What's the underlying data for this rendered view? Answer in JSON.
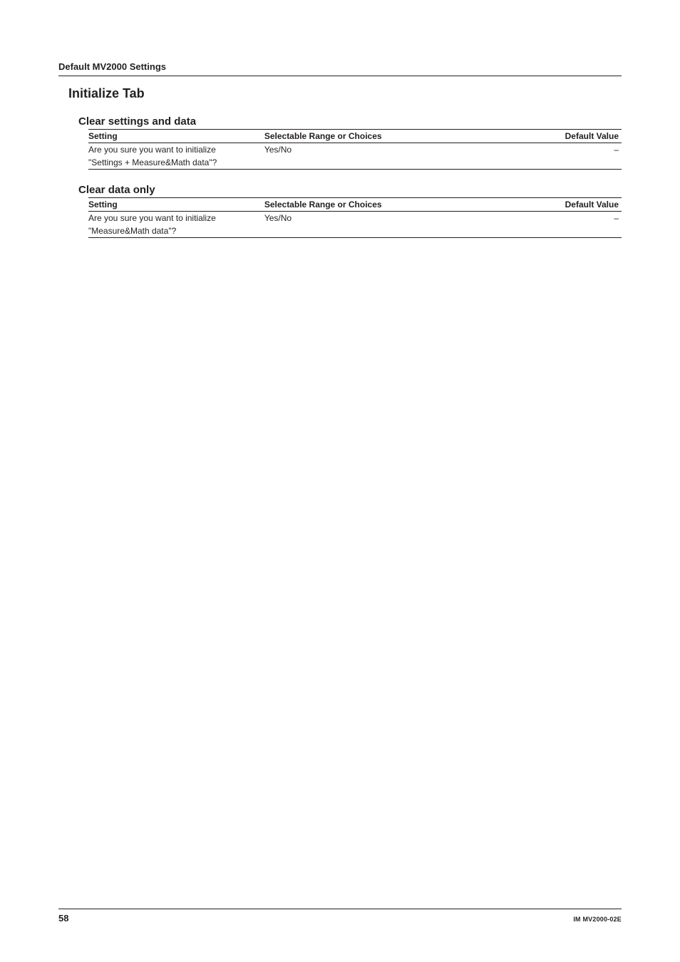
{
  "running_header": "Default MV2000 Settings",
  "tab_title": "Initialize Tab",
  "table_headers": {
    "setting": "Setting",
    "choices": "Selectable Range or Choices",
    "default": "Default Value"
  },
  "sections": [
    {
      "title": "Clear settings and data",
      "rows": [
        {
          "setting_l1": "Are you sure you want to initialize",
          "setting_l2": "\"Settings + Measure&Math data\"?",
          "choices": "Yes/No",
          "default": "–"
        }
      ]
    },
    {
      "title": "Clear data only",
      "rows": [
        {
          "setting_l1": "Are you sure you want to initialize",
          "setting_l2": "\"Measure&Math data\"?",
          "choices": "Yes/No",
          "default": "–"
        }
      ]
    }
  ],
  "footer": {
    "page_number": "58",
    "doc_id": "IM MV2000-02E"
  }
}
